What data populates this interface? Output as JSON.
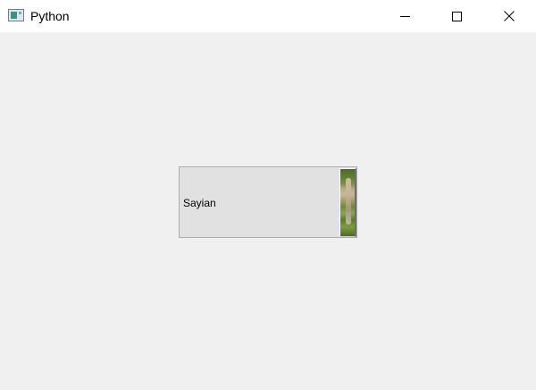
{
  "window": {
    "title": "Python",
    "icon": "python-app-icon",
    "controls": {
      "minimize_icon": "minimize-icon",
      "maximize_icon": "maximize-icon",
      "close_icon": "close-icon"
    }
  },
  "main": {
    "push_button": {
      "label": "Sayian",
      "icon": "image-thumbnail-icon"
    }
  },
  "colors": {
    "window_background": "#f0f0f0",
    "titlebar_background": "#ffffff",
    "button_face": "#e1e1e1",
    "button_border": "#adadad"
  }
}
